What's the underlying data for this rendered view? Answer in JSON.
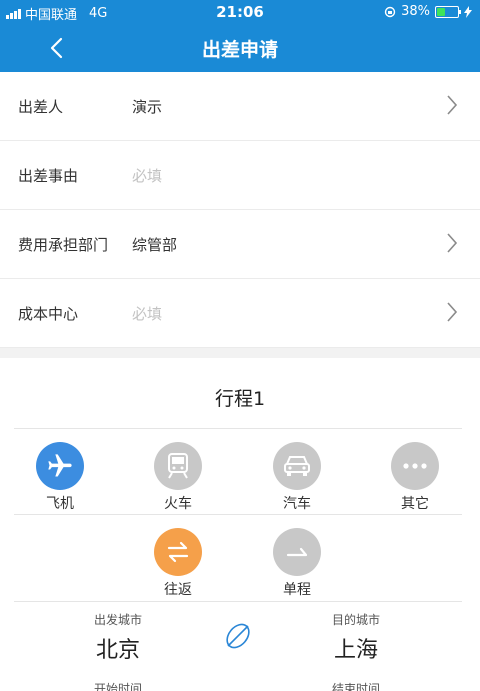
{
  "status_bar": {
    "carrier": "中国联通",
    "network": "4G",
    "time": "21:06",
    "battery_percent": "38%",
    "battery_level": 0.38
  },
  "nav": {
    "title": "出差申请",
    "back_icon": "chevron-left-icon"
  },
  "form": {
    "traveler": {
      "label": "出差人",
      "value": "演示"
    },
    "reason": {
      "label": "出差事由",
      "placeholder": "必填"
    },
    "department": {
      "label": "费用承担部门",
      "value": "综管部"
    },
    "cost_center": {
      "label": "成本中心",
      "placeholder": "必填"
    }
  },
  "trip": {
    "title": "行程1",
    "transport_modes": [
      {
        "label": "飞机",
        "icon": "airplane-icon",
        "selected": true
      },
      {
        "label": "火车",
        "icon": "train-icon",
        "selected": false
      },
      {
        "label": "汽车",
        "icon": "car-icon",
        "selected": false
      },
      {
        "label": "其它",
        "icon": "more-icon",
        "selected": false
      }
    ],
    "trip_types": [
      {
        "label": "往返",
        "icon": "round-trip-icon",
        "selected": true
      },
      {
        "label": "单程",
        "icon": "one-way-icon",
        "selected": false
      }
    ],
    "departure": {
      "caption": "出发城市",
      "city": "北京"
    },
    "destination": {
      "caption": "目的城市",
      "city": "上海"
    },
    "start_time_caption": "开始时间",
    "end_time_caption": "结束时间"
  },
  "colors": {
    "header_blue": "#1a8ad6",
    "selected_blue": "#3c8de0",
    "selected_orange": "#f5a04a",
    "unselected_grey": "#c8c8c8"
  }
}
